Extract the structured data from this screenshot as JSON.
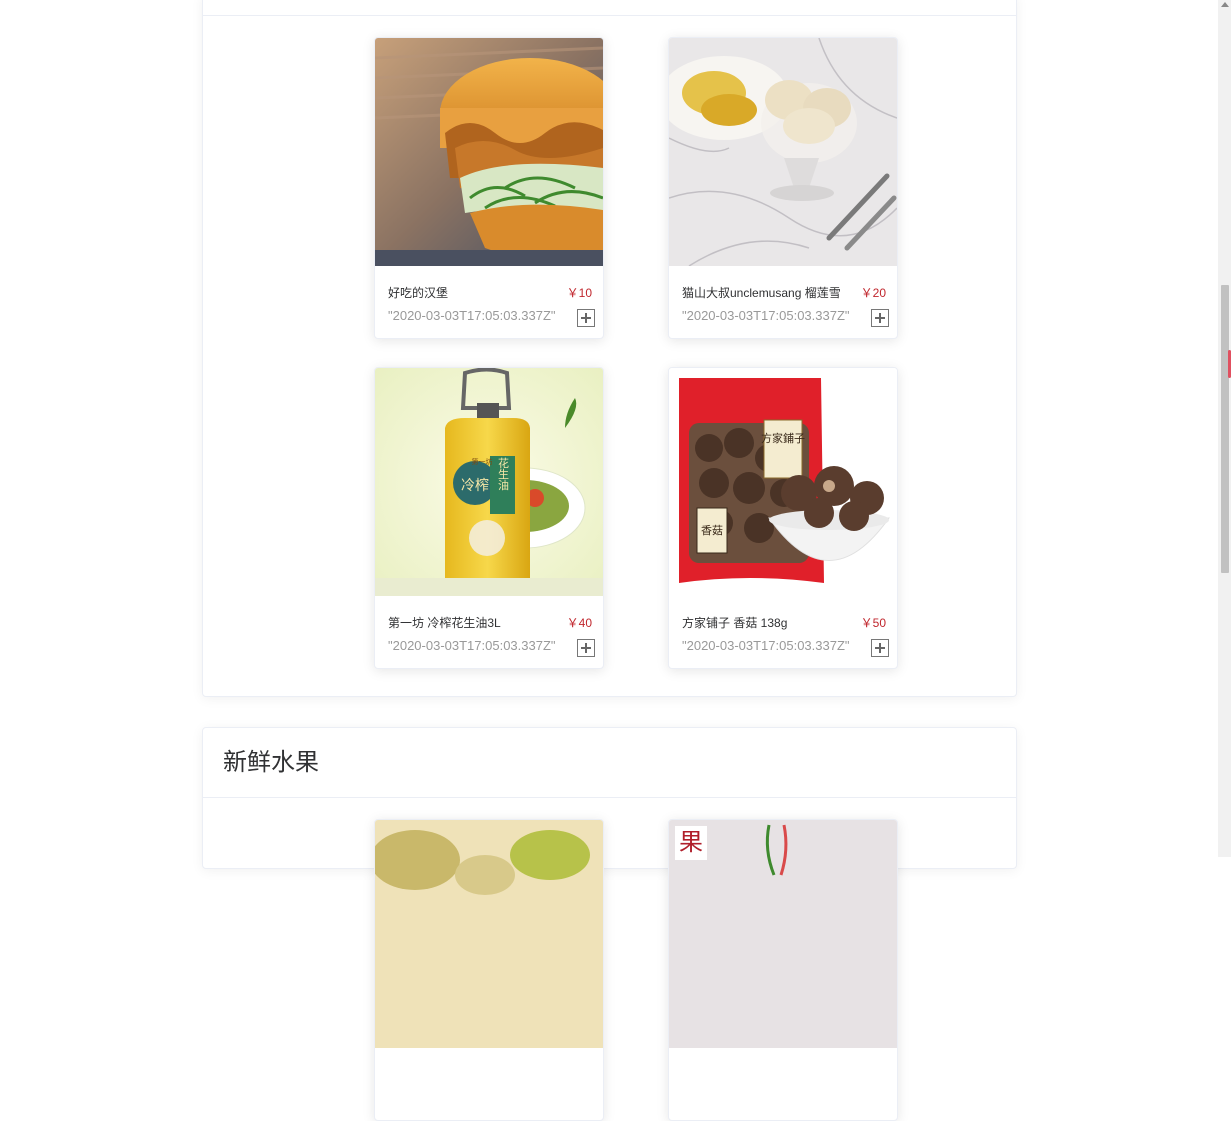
{
  "sections": [
    {
      "title": "",
      "products": [
        {
          "name": "好吃的汉堡",
          "price": "￥10",
          "date": "\"2020-03-03T17:05:03.337Z\"",
          "image": "burger-image"
        },
        {
          "name": "猫山大叔unclemusang 榴莲雪",
          "price": "￥20",
          "date": "\"2020-03-03T17:05:03.337Z\"",
          "image": "durian-ice-cream-image"
        },
        {
          "name": "第一坊 冷榨花生油3L",
          "price": "￥40",
          "date": "\"2020-03-03T17:05:03.337Z\"",
          "image": "peanut-oil-image"
        },
        {
          "name": "方家铺子 香菇 138g",
          "price": "￥50",
          "date": "\"2020-03-03T17:05:03.337Z\"",
          "image": "mushroom-image"
        }
      ]
    },
    {
      "title": "新鲜水果",
      "products": [
        {
          "image": "fruit-image"
        },
        {
          "image": "fruit-box-image"
        }
      ]
    }
  ],
  "image_text": {
    "oil_brand": "第一坊",
    "oil_label": "花生油",
    "oil_cold": "冷榨",
    "mushroom_brand": "方家鋪子",
    "mushroom_label": "香菇",
    "fruit_char": "果"
  },
  "colors": {
    "price": "#c0262d",
    "date": "#999999",
    "border": "#ebeef5"
  }
}
